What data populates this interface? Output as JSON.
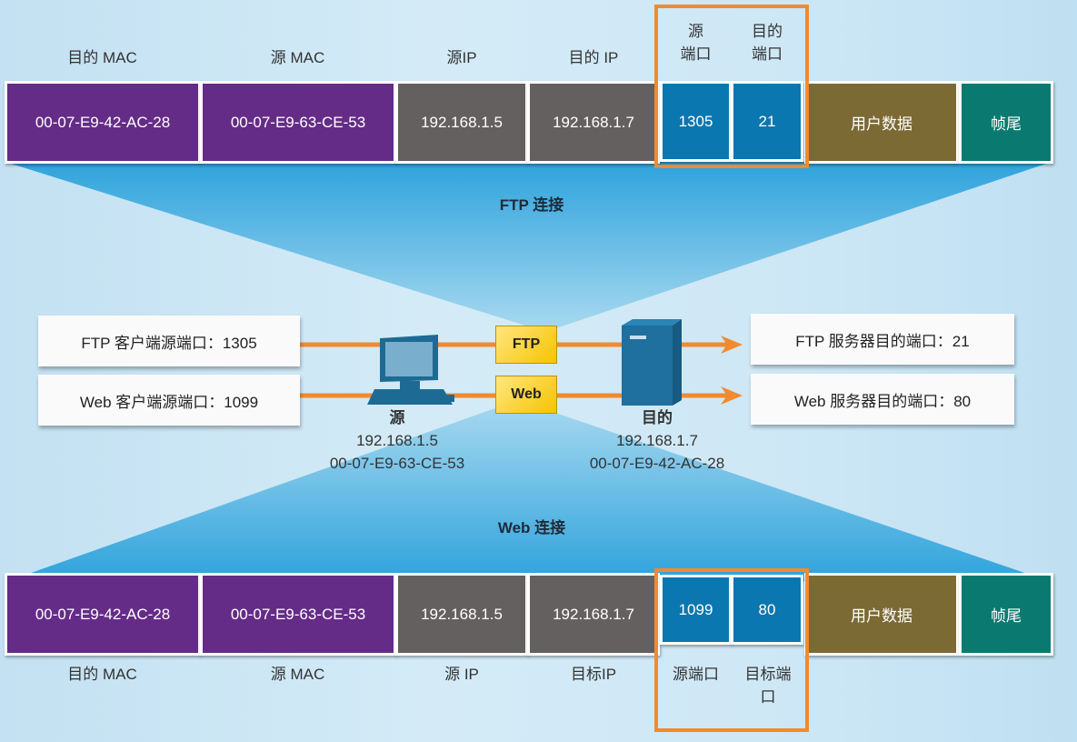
{
  "top_frame": {
    "headers": [
      "目的 MAC",
      "源 MAC",
      "源IP",
      "目的 IP",
      "源\n端口",
      "目的\n端口"
    ],
    "header_lines": {
      "src_port": [
        "源",
        "端口"
      ],
      "dst_port": [
        "目的",
        "端口"
      ]
    },
    "cells": [
      "00-07-E9-42-AC-28",
      "00-07-E9-63-CE-53",
      "192.168.1.5",
      "192.168.1.7",
      "1305",
      "21",
      "用户数据",
      "帧尾"
    ]
  },
  "ftp_connection_label": "FTP 连接",
  "web_connection_label": "Web 连接",
  "left_boxes": [
    "FTP 客户端源端口：1305",
    "Web 客户端源端口：1099"
  ],
  "right_boxes": [
    "FTP 服务器目的端口：21",
    "Web 服务器目的端口：80"
  ],
  "envelopes": [
    "FTP",
    "Web"
  ],
  "source": {
    "title": "源",
    "ip": "192.168.1.5",
    "mac": "00-07-E9-63-CE-53"
  },
  "destination": {
    "title": "目的",
    "ip": "192.168.1.7",
    "mac": "00-07-E9-42-AC-28"
  },
  "bottom_frame": {
    "cells": [
      "00-07-E9-42-AC-28",
      "00-07-E9-63-CE-53",
      "192.168.1.5",
      "192.168.1.7",
      "1099",
      "80",
      "用户数据",
      "帧尾"
    ],
    "footers": [
      "目的 MAC",
      "源 MAC",
      "源 IP",
      "目标IP",
      "源端口"
    ],
    "dst_port_lines": [
      "目标端",
      "口"
    ]
  },
  "colors": {
    "mac": "#652c87",
    "ip": "#646060",
    "port": "#0a77b0",
    "data": "#7b6a34",
    "trailer": "#0a7a70",
    "highlight": "#f28a2e"
  }
}
